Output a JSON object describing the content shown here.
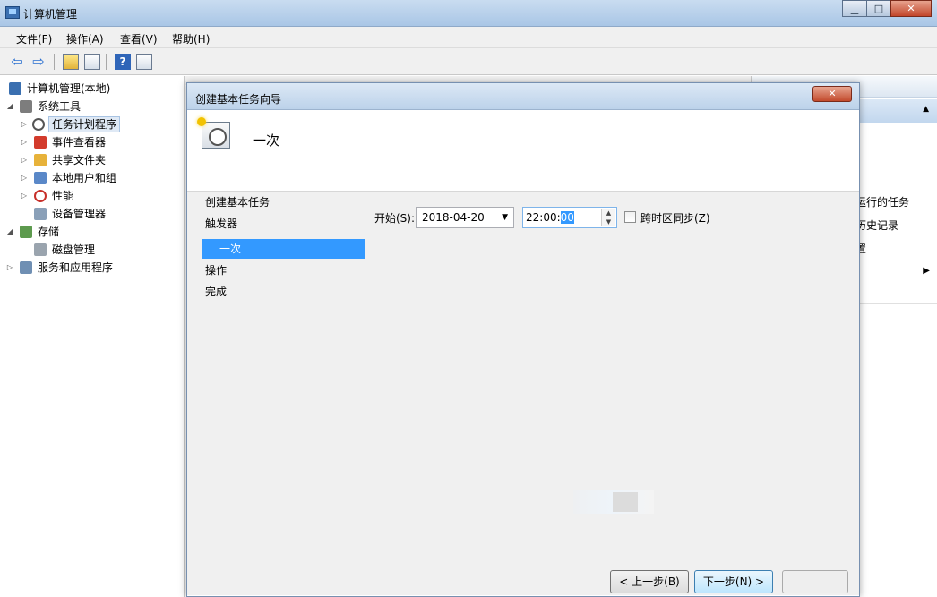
{
  "window": {
    "title": "计算机管理"
  },
  "menu": [
    "文件(F)",
    "操作(A)",
    "查看(V)",
    "帮助(H)"
  ],
  "tree": [
    {
      "label": "计算机管理(本地)"
    },
    {
      "label": "系统工具"
    },
    {
      "label": "任务计划程序"
    },
    {
      "label": "事件查看器"
    },
    {
      "label": "共享文件夹"
    },
    {
      "label": "本地用户和组"
    },
    {
      "label": "性能"
    },
    {
      "label": "设备管理器"
    },
    {
      "label": "存储"
    },
    {
      "label": "磁盘管理"
    },
    {
      "label": "服务和应用程序"
    }
  ],
  "actions": {
    "items": [
      "运行的任务",
      "历史记录",
      "置"
    ]
  },
  "dialog": {
    "title": "创建基本任务向导",
    "heading": "一次",
    "steps": [
      "创建基本任务",
      "触发器",
      "一次",
      "操作",
      "完成"
    ],
    "start_label": "开始(S):",
    "date": "2018-04-20",
    "time_prefix": "22:00:",
    "time_selected": "00",
    "sync_label": "跨时区同步(Z)",
    "back_button": "< 上一步(B)",
    "next_button": "下一步(N) >"
  }
}
